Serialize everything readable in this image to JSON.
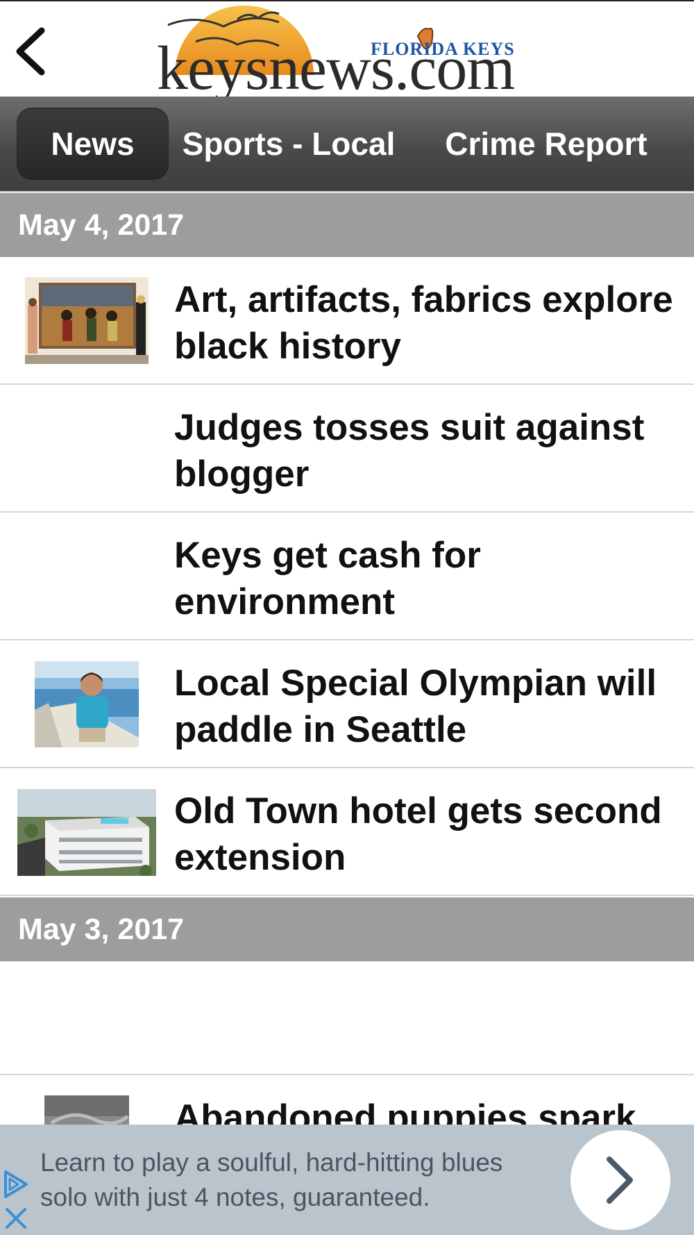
{
  "header": {
    "logo_main": "keysnews.com",
    "logo_tagline": "FLORIDA KEYS"
  },
  "tabs": [
    {
      "label": "News",
      "active": true
    },
    {
      "label": "Sports - Local",
      "active": false
    },
    {
      "label": "Crime Report",
      "active": false
    }
  ],
  "sections": [
    {
      "date": "May 4, 2017",
      "articles": [
        {
          "title": "Art, artifacts, fabrics explore black history",
          "has_image": true
        },
        {
          "title": "Judges tosses suit against blogger",
          "has_image": false
        },
        {
          "title": "Keys get cash for environment",
          "has_image": false
        },
        {
          "title": "Local Special Olympian will paddle in Seattle",
          "has_image": true
        },
        {
          "title": "Old Town hotel gets second extension",
          "has_image": true
        }
      ]
    },
    {
      "date": "May 3, 2017",
      "articles": [
        {
          "title": "",
          "has_image": false
        },
        {
          "title": "Abandoned puppies spark",
          "has_image": true
        }
      ]
    }
  ],
  "ad": {
    "text": "Learn to play a soulful, hard-hitting blues solo with just 4 notes, guaranteed."
  },
  "colors": {
    "date_header_bg": "#9d9d9d",
    "nav_bg": "#4a4a4a",
    "ad_bg": "#b9c4cc",
    "logo_blue": "#1e55a4",
    "sun": "#f0a830"
  }
}
